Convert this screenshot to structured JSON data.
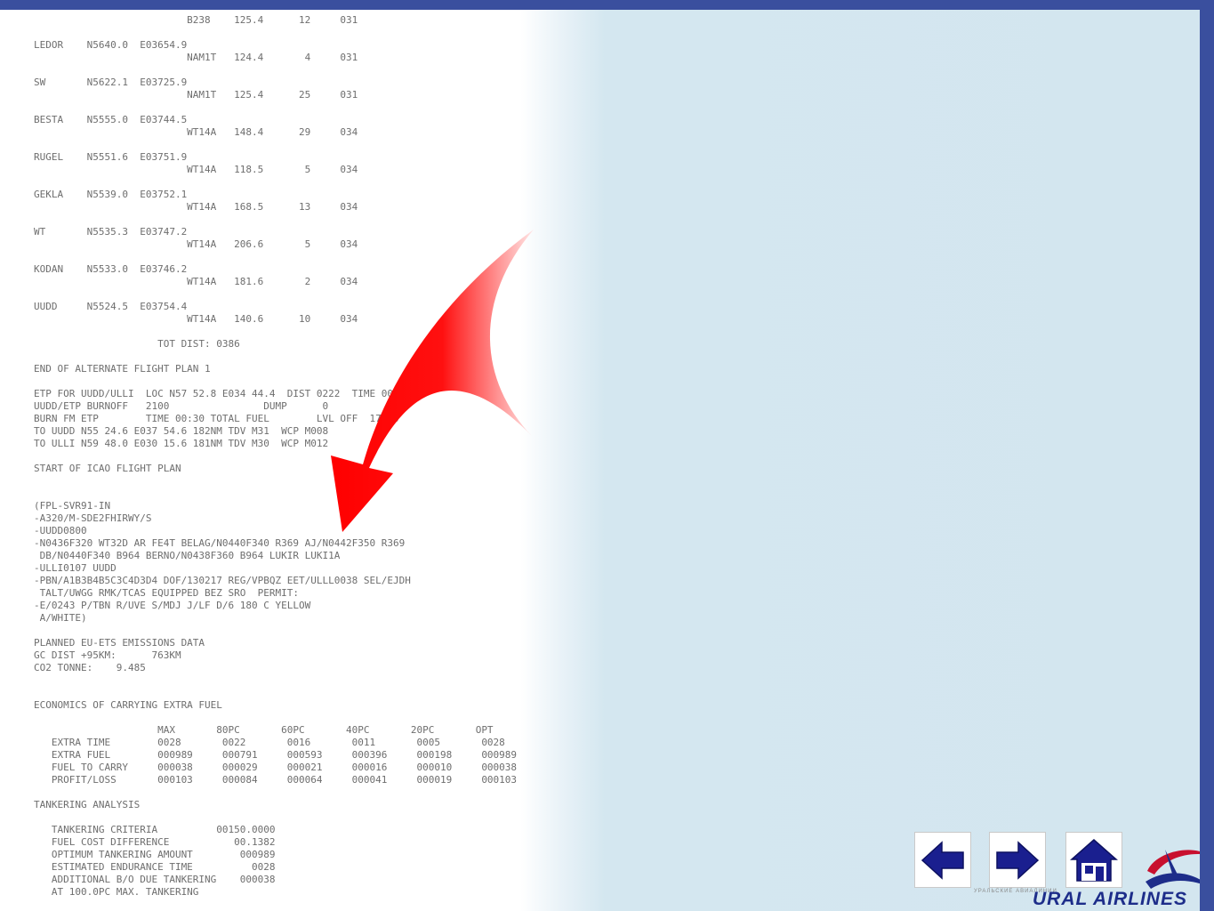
{
  "document": {
    "text": "                          B238    125.4      12     031\n\nLEDOR    N5640.0  E03654.9\n                          NAM1T   124.4       4     031\n\nSW       N5622.1  E03725.9\n                          NAM1T   125.4      25     031\n\nBESTA    N5555.0  E03744.5\n                          WT14A   148.4      29     034\n\nRUGEL    N5551.6  E03751.9\n                          WT14A   118.5       5     034\n\nGEKLA    N5539.0  E03752.1\n                          WT14A   168.5      13     034\n\nWT       N5535.3  E03747.2\n                          WT14A   206.6       5     034\n\nKODAN    N5533.0  E03746.2\n                          WT14A   181.6       2     034\n\nUUDD     N5524.5  E03754.4\n                          WT14A   140.6      10     034\n\n                     TOT DIST: 0386\n\nEND OF ALTERNATE FLIGHT PLAN 1\n\nETP FOR UUDD/ULLI  LOC N57 52.8 E034 44.4  DIST 0222  TIME 00:35\nUUDD/ETP BURNOFF   2100                DUMP      0\nBURN FM ETP        TIME 00:30 TOTAL FUEL        LVL OFF  17000\nTO UUDD N55 24.6 E037 54.6 182NM TDV M31  WCP M008\nTO ULLI N59 48.0 E030 15.6 181NM TDV M30  WCP M012\n\nSTART OF ICAO FLIGHT PLAN\n\n\n(FPL-SVR91-IN\n-A320/M-SDE2FHIRWY/S\n-UUDD0800\n-N0436F320 WT32D AR FE4T BELAG/N0440F340 R369 AJ/N0442F350 R369\n DB/N0440F340 B964 BERNO/N0438F360 B964 LUKIR LUKI1A\n-ULLI0107 UUDD\n-PBN/A1B3B4B5C3C4D3D4 DOF/130217 REG/VPBQZ EET/ULLL0038 SEL/EJDH\n TALT/UWGG RMK/TCAS EQUIPPED BEZ SRO  PERMIT:\n-E/0243 P/TBN R/UVE S/MDJ J/LF D/6 180 C YELLOW\n A/WHITE)\n\nPLANNED EU-ETS EMISSIONS DATA\nGC DIST +95KM:      763KM\nCO2 TONNE:    9.485\n\n\nECONOMICS OF CARRYING EXTRA FUEL\n\n                     MAX       80PC       60PC       40PC       20PC       OPT\n   EXTRA TIME        0028       0022       0016       0011       0005       0028\n   EXTRA FUEL        000989     000791     000593     000396     000198     000989\n   FUEL TO CARRY     000038     000029     000021     000016     000010     000038\n   PROFIT/LOSS       000103     000084     000064     000041     000019     000103\n\nTANKERING ANALYSIS\n\n   TANKERING CRITERIA          00150.0000\n   FUEL COST DIFFERENCE           00.1382\n   OPTIMUM TANKERING AMOUNT        000989\n   ESTIMATED ENDURANCE TIME          0028\n   ADDITIONAL B/O DUE TANKERING    000038\n   AT 100.0PC MAX. TANKERING"
  },
  "navigation": {
    "back_icon": "left-arrow-icon",
    "forward_icon": "right-arrow-icon",
    "home_icon": "home-icon"
  },
  "logo": {
    "name": "URAL AIRLINES",
    "tagline": "УРАЛЬСКИЕ АВИАЛИНИИ"
  },
  "colors": {
    "frame": "#3a4f9e",
    "background": "#d3e6ef",
    "arrow": "#ff0000",
    "nav_icon": "#1a1f8f",
    "logo_text": "#1d2d8a"
  }
}
